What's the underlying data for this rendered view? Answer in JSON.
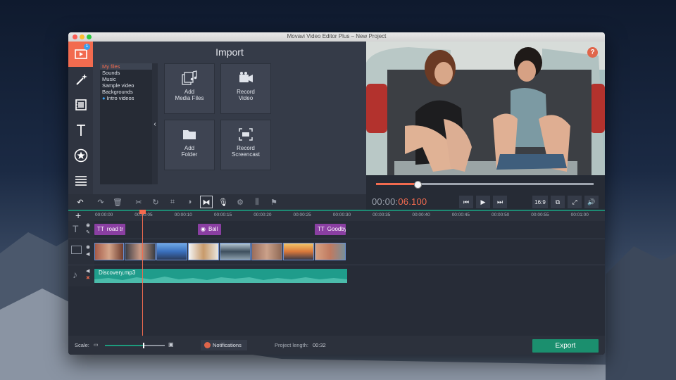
{
  "window": {
    "title": "Movavi Video Editor Plus – New Project"
  },
  "colors": {
    "accent": "#f26b4f",
    "export": "#1b8f6e",
    "title_clip": "#8a3fa2",
    "audio": "#1f9c8b"
  },
  "tools": [
    {
      "icon": "import-media-icon",
      "badge": "1",
      "active": true
    },
    {
      "icon": "magic-wand-icon"
    },
    {
      "icon": "filters-film-icon"
    },
    {
      "icon": "titles-text-icon"
    },
    {
      "icon": "stickers-star-icon"
    },
    {
      "icon": "more-menu-icon"
    }
  ],
  "import": {
    "heading": "Import",
    "categories": [
      "My files",
      "Sounds",
      "Music",
      "Sample video",
      "Backgrounds",
      "Intro videos"
    ],
    "selected_category": "My files",
    "buttons": {
      "add_media_1": "Add",
      "add_media_2": "Media Files",
      "record_video_1": "Record",
      "record_video_2": "Video",
      "add_folder_1": "Add",
      "add_folder_2": "Folder",
      "record_screen_1": "Record",
      "record_screen_2": "Screencast"
    }
  },
  "preview": {
    "help": "?",
    "progress_fraction": 0.19
  },
  "player": {
    "timecode_prefix": "00:00:",
    "timecode_value": "06.100",
    "aspect": "16:9"
  },
  "ruler": {
    "ticks": [
      "00:00:00",
      "00:00:05",
      "00:00:10",
      "00:00:15",
      "00:00:20",
      "00:00:25",
      "00:00:30",
      "00:00:35",
      "00:00:40",
      "00:00:45",
      "00:00:50",
      "00:00:55",
      "00:01:00"
    ]
  },
  "timeline": {
    "title_clips": [
      "road tr",
      "Ball",
      "Goodby"
    ],
    "audio_clip": "Discovery.mp3"
  },
  "footer": {
    "scale_label": "Scale:",
    "scale_fraction": 0.63,
    "notifications": "Notifications",
    "project_length_label": "Project length:",
    "project_length_value": "00:32",
    "export": "Export"
  }
}
